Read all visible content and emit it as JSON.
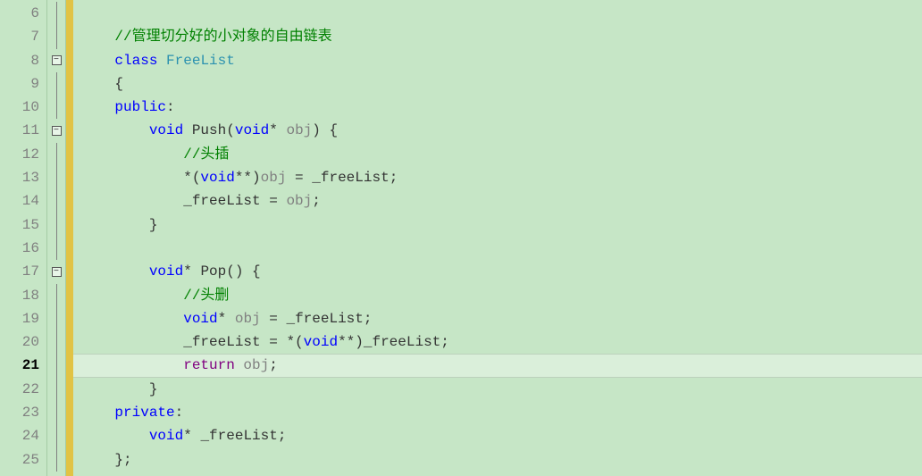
{
  "gutter": {
    "lines": [
      "6",
      "7",
      "8",
      "9",
      "10",
      "11",
      "12",
      "13",
      "14",
      "15",
      "16",
      "17",
      "18",
      "19",
      "20",
      "21",
      "22",
      "23",
      "24",
      "25"
    ],
    "current_index": 15
  },
  "fold": {
    "markers": {
      "2": "minus",
      "5": "minus",
      "11": "minus"
    }
  },
  "tokens": {
    "comment1": "//管理切分好的小对象的自由链表",
    "kw_class": "class",
    "type_freelist": "FreeList",
    "brace_open": "{",
    "kw_public": "public",
    "colon": ":",
    "kw_void": "void",
    "fn_push": "Push",
    "paren_open": "(",
    "star": "*",
    "param_obj": "obj",
    "paren_close": ")",
    "space_brace": " {",
    "comment2": "//头插",
    "star_open": "*(",
    "dstar": "**",
    "close_paren": ")",
    "eq": " = ",
    "member_freelist": "_freeList",
    "semi": ";",
    "brace_close": "}",
    "fn_pop": "Pop",
    "empty_parens": "() {",
    "comment3": "//头删",
    "kw_return": "return",
    "ret_obj": " obj",
    "kw_private": "private",
    "class_close": "};"
  },
  "chart_data": null
}
